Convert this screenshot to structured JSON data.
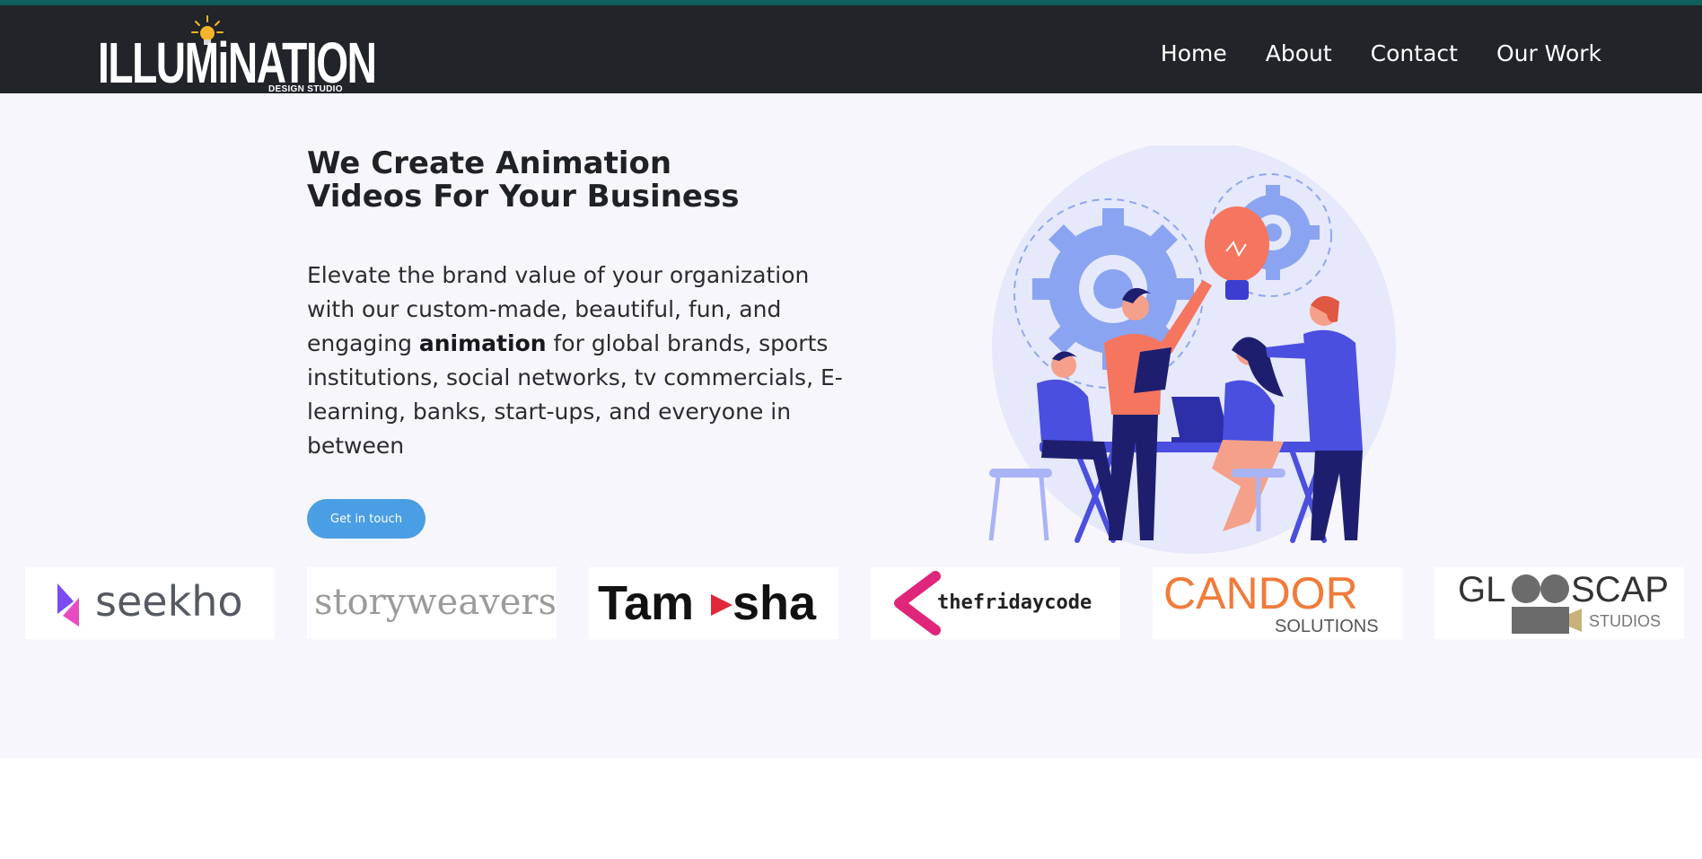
{
  "brand": {
    "name": "ILLUMiNATION",
    "tagline": "DESIGN STUDIO"
  },
  "nav": {
    "items": [
      "Home",
      "About",
      "Contact",
      "Our Work"
    ]
  },
  "hero": {
    "title_line1": "We Create Animation",
    "title_line2": "Videos For Your Business",
    "desc_before": "Elevate the brand value of your organization with our custom-made, beautiful, fun, and engaging ",
    "desc_bold": "animation",
    "desc_after": " for global brands, sports institutions, social networks, tv commercials, E-learning, banks, start-ups, and everyone in between",
    "cta_label": "Get in touch"
  },
  "clients": {
    "seekho": "seekho",
    "storyweavers": "storyweavers",
    "tamasha_left": "Tam",
    "tamasha_right": "sha",
    "fridaycode": "thefridaycode",
    "candor_main": "CANDOR",
    "candor_sub": "SOLUTIONS",
    "glooscap_left": "GL",
    "glooscap_right": "SCAP",
    "glooscap_sub": "STUDIOS"
  },
  "colors": {
    "accent_bar": "#10615f",
    "nav_bg": "#212428",
    "hero_bg": "#f8f6fd",
    "cta_bg": "#4a9ee3",
    "illustration_primary": "#4a4fe0",
    "illustration_accent": "#f5755f"
  },
  "icons": {
    "logo": "lightbulb-logo-icon",
    "illustration": "team-brainstorm-illustration"
  }
}
